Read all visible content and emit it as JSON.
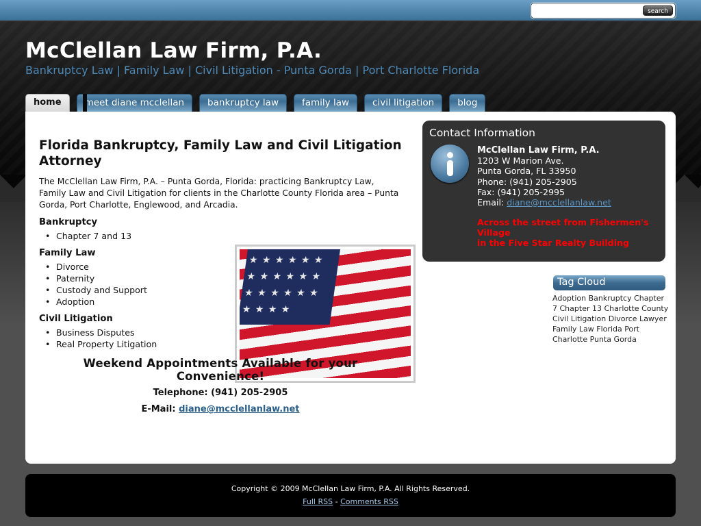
{
  "search": {
    "placeholder": "",
    "value": "",
    "button_label": "search"
  },
  "header": {
    "title": "McClellan Law Firm, P.A.",
    "tagline": "Bankruptcy Law | Family Law | Civil Litigation - Punta Gorda | Port Charlotte Florida"
  },
  "nav": {
    "tabs": [
      {
        "label": "home",
        "active": true
      },
      {
        "label": "meet diane mcclellan",
        "active": false
      },
      {
        "label": "bankruptcy law",
        "active": false
      },
      {
        "label": "family law",
        "active": false
      },
      {
        "label": "civil litigation",
        "active": false
      },
      {
        "label": "blog",
        "active": false
      }
    ]
  },
  "main": {
    "heading": "Florida Bankruptcy, Family Law and Civil Litigation Attorney",
    "intro": "The McClellan Law Firm, P.A. – Punta Gorda, Florida: practicing Bankruptcy Law, Family Law and Civil Litigation for clients in the Charlotte County Florida area – Punta Gorda, Port Charlotte, Englewood, and Arcadia.",
    "sections": [
      {
        "title": "Bankruptcy",
        "items": [
          "Chapter 7 and 13"
        ]
      },
      {
        "title": "Family Law",
        "items": [
          "Divorce",
          "Paternity",
          "Custody and Support",
          "Adoption"
        ]
      },
      {
        "title": "Civil Litigation",
        "items": [
          "Business Disputes",
          "Real Property Litigation"
        ]
      }
    ],
    "image_alt": "American flag",
    "weekend": "Weekend Appointments Available for your Convenience!",
    "telephone": "Telephone: (941) 205-2905",
    "email_label": "E-Mail:",
    "email": "diane@mcclellanlaw.net"
  },
  "contact": {
    "title": "Contact Information",
    "firm": "McClellan Law Firm, P.A.",
    "address1": "1203 W Marion Ave.",
    "address2": "Punta Gorda, FL 33950",
    "phone": "Phone: (941) 205-2905",
    "fax": "Fax: (941) 205-2995",
    "email_label": "Email:",
    "email": "diane@mcclellanlaw.net",
    "note1": "Across the street from Fishermen's Village",
    "note2": "in the Five Star Realty Building"
  },
  "tagcloud": {
    "title": "Tag Cloud",
    "tags": [
      "Adoption",
      "Bankruptcy",
      "Chapter 7",
      "Chapter 13",
      "Charlotte County",
      "Civil Litigation",
      "Divorce Lawyer",
      "Family Law",
      "Florida",
      "Port Charlotte",
      "Punta Gorda"
    ]
  },
  "footer": {
    "copyright": "Copyright © 2009 McClellan Law Firm, P.A. All Rights Reserved.",
    "full_rss": "Full RSS",
    "separator": "-",
    "comments_rss": "Comments RSS"
  }
}
